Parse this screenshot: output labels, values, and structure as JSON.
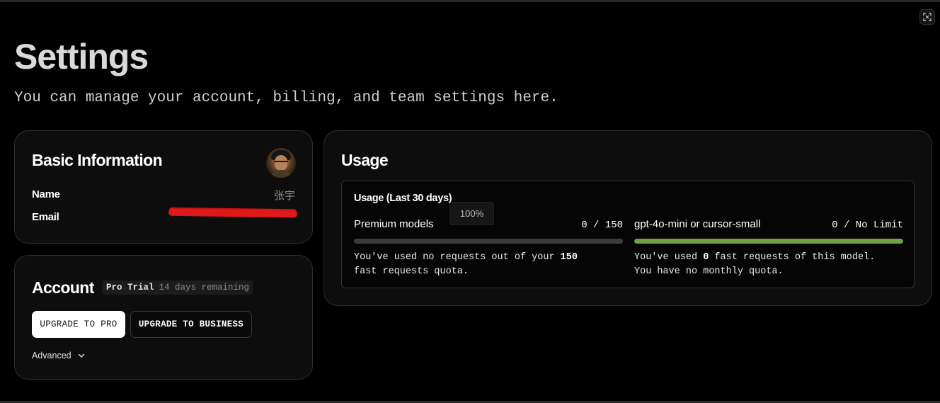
{
  "header": {
    "title": "Settings",
    "subtitle": "You can manage your account, billing, and team settings here."
  },
  "basic_info": {
    "title": "Basic Information",
    "name_label": "Name",
    "name_value": "张宇",
    "email_label": "Email"
  },
  "account": {
    "title": "Account",
    "plan": "Pro Trial",
    "remaining": "14 days remaining",
    "upgrade_pro_label": "UPGRADE TO PRO",
    "upgrade_business_label": "UPGRADE TO BUSINESS",
    "advanced_label": "Advanced"
  },
  "usage": {
    "title": "Usage",
    "period_label": "Usage (Last 30 days)",
    "tooltip": "100%",
    "meters": [
      {
        "name": "Premium models",
        "count": "0 / 150",
        "fill_fraction": 0,
        "bar_color": "#3b3b3b",
        "desc_line1_pre": "You've used no requests out of your ",
        "desc_line1_bold": "150",
        "desc_line2": "fast requests quota."
      },
      {
        "name": "gpt-4o-mini or cursor-small",
        "count": "0 / No Limit",
        "fill_fraction": 1,
        "bar_color": "#6ea342",
        "desc_line1_pre": "You've used ",
        "desc_line1_bold": "0",
        "desc_line1_post": " fast requests of this model.",
        "desc_line2": "You have no monthly quota."
      }
    ]
  },
  "icons": {
    "expand": "expand-icon",
    "chevron": "chevron-down-icon",
    "avatar": "avatar"
  },
  "colors": {
    "background": "#000000",
    "card": "#0d0d0d",
    "redaction": "#e01a1a",
    "progress_green": "#6ea342"
  }
}
